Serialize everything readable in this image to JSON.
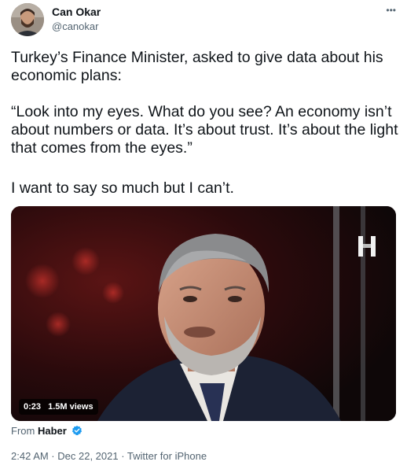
{
  "author": {
    "name": "Can Okar",
    "handle": "@canokar"
  },
  "more_icon": "more-dots-icon",
  "tweet": {
    "paragraph_1": "Turkey’s Finance Minister, asked to give data about his economic plans:",
    "paragraph_2": "“Look into my eyes. What do you see? An economy isn’t about numbers or data. It’s about trust. It’s about the light that comes from the eyes.”",
    "paragraph_3": "I want to say so much but I can’t."
  },
  "media": {
    "duration": "0:23",
    "views": "1.5M views",
    "channel_logo": "H"
  },
  "source": {
    "prefix": "From",
    "name": "Haber",
    "verified_icon": "verified-badge-icon"
  },
  "meta": {
    "line": "2:42 AM · Dec 22, 2021 · Twitter for iPhone"
  },
  "colors": {
    "text_primary": "#0f1419",
    "text_secondary": "#536471",
    "verified_blue": "#1d9bf0"
  }
}
